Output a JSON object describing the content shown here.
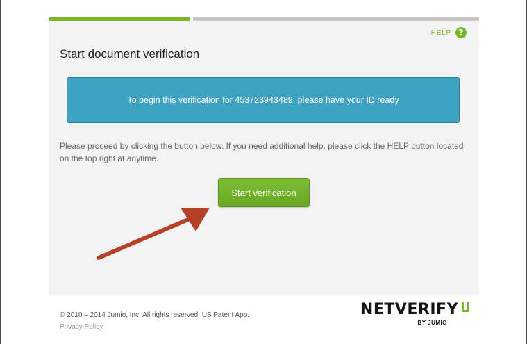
{
  "progress": {
    "active_step": 1,
    "total_steps": 2
  },
  "header": {
    "help_label": "HELP",
    "help_icon": "?"
  },
  "main": {
    "title": "Start document verification",
    "info_message": "To begin this verification for 453723943489, please have your ID ready",
    "instructions": "Please proceed by clicking the button below. If you need additional help, please click the HELP button located on the top right at anytime.",
    "start_button_label": "Start verification"
  },
  "footer": {
    "copyright": "© 2010 – 2014 Jumio, Inc. All rights reserved. US Patent App.",
    "privacy_link": "Privacy Policy",
    "logo_text": "NETVERIFY",
    "logo_sub": "BY JUMIO"
  },
  "colors": {
    "accent_green": "#78b82a",
    "info_blue": "#3ea3c3",
    "progress_inactive": "#c8c8c8",
    "annotation_arrow": "#b6412a"
  },
  "icons": {
    "help": "help-question-icon",
    "annotation": "annotation-arrow-icon"
  }
}
